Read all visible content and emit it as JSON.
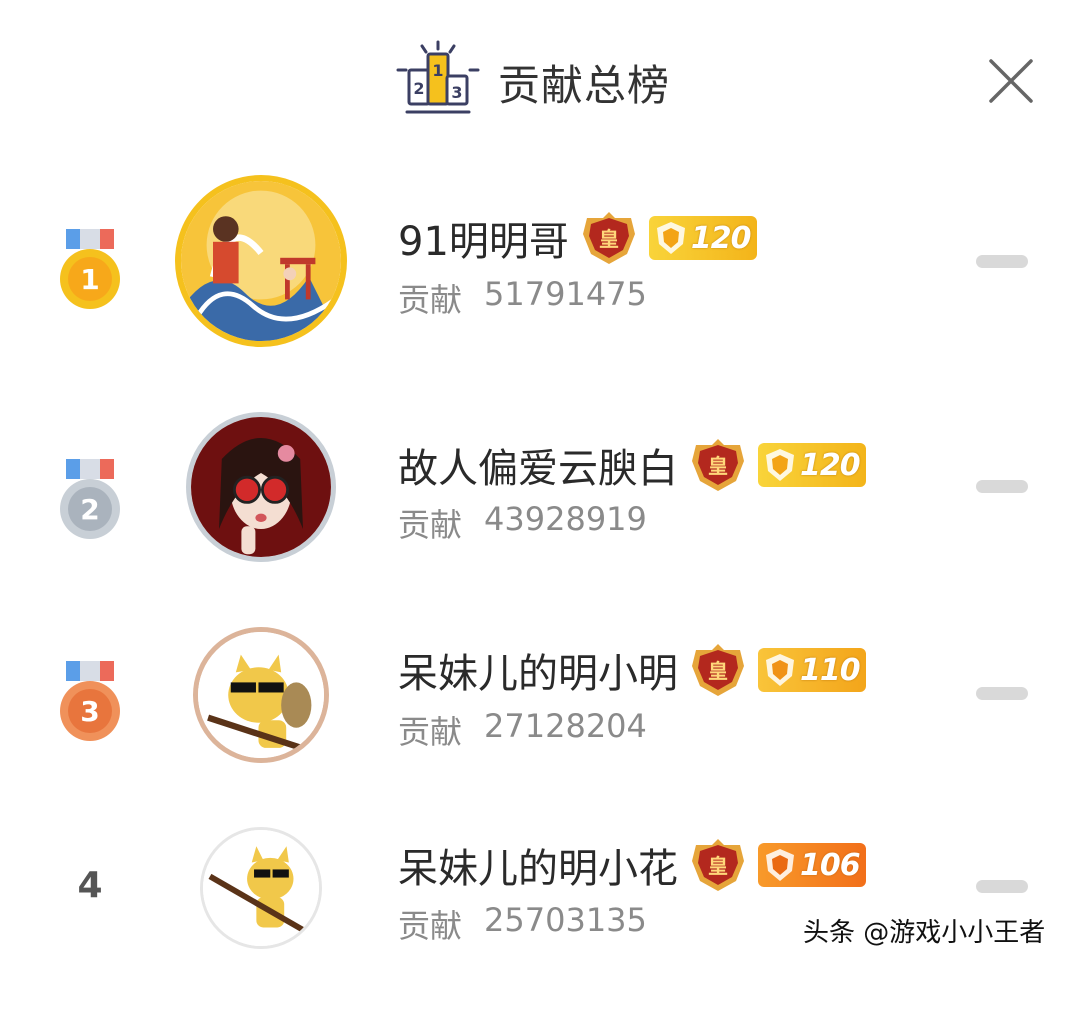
{
  "header": {
    "title": "贡献总榜",
    "podium_icon": "podium-icon",
    "podium_labels": [
      "2",
      "1",
      "3"
    ],
    "close_icon": "close-icon"
  },
  "contribution_label": "贡献",
  "rows": [
    {
      "rank": "1",
      "medal": "gold-medal-icon",
      "name": "91明明哥",
      "crown_icon": "crown-badge-icon",
      "crown_text": "皇",
      "level": "120",
      "level_style": "gold",
      "contribution": "51791475"
    },
    {
      "rank": "2",
      "medal": "silver-medal-icon",
      "name": "故人偏爱云腴白",
      "crown_icon": "crown-badge-icon",
      "crown_text": "皇",
      "level": "120",
      "level_style": "gold",
      "contribution": "43928919"
    },
    {
      "rank": "3",
      "medal": "bronze-medal-icon",
      "name": "呆妹儿的明小明",
      "crown_icon": "crown-badge-icon",
      "crown_text": "皇",
      "level": "110",
      "level_style": "amber",
      "contribution": "27128204"
    },
    {
      "rank": "4",
      "medal": null,
      "name": "呆妹儿的明小花",
      "crown_icon": "crown-badge-icon",
      "crown_text": "皇",
      "level": "106",
      "level_style": "orange",
      "contribution": "25703135"
    }
  ],
  "watermark": "头条 @游戏小小王者",
  "colors": {
    "gold": "#f5c11d",
    "silver": "#c8cfd6",
    "bronze": "#f0915a",
    "level_gold": "#f7c21b",
    "level_orange": "#f7831e",
    "crown_red": "#b3281e"
  }
}
